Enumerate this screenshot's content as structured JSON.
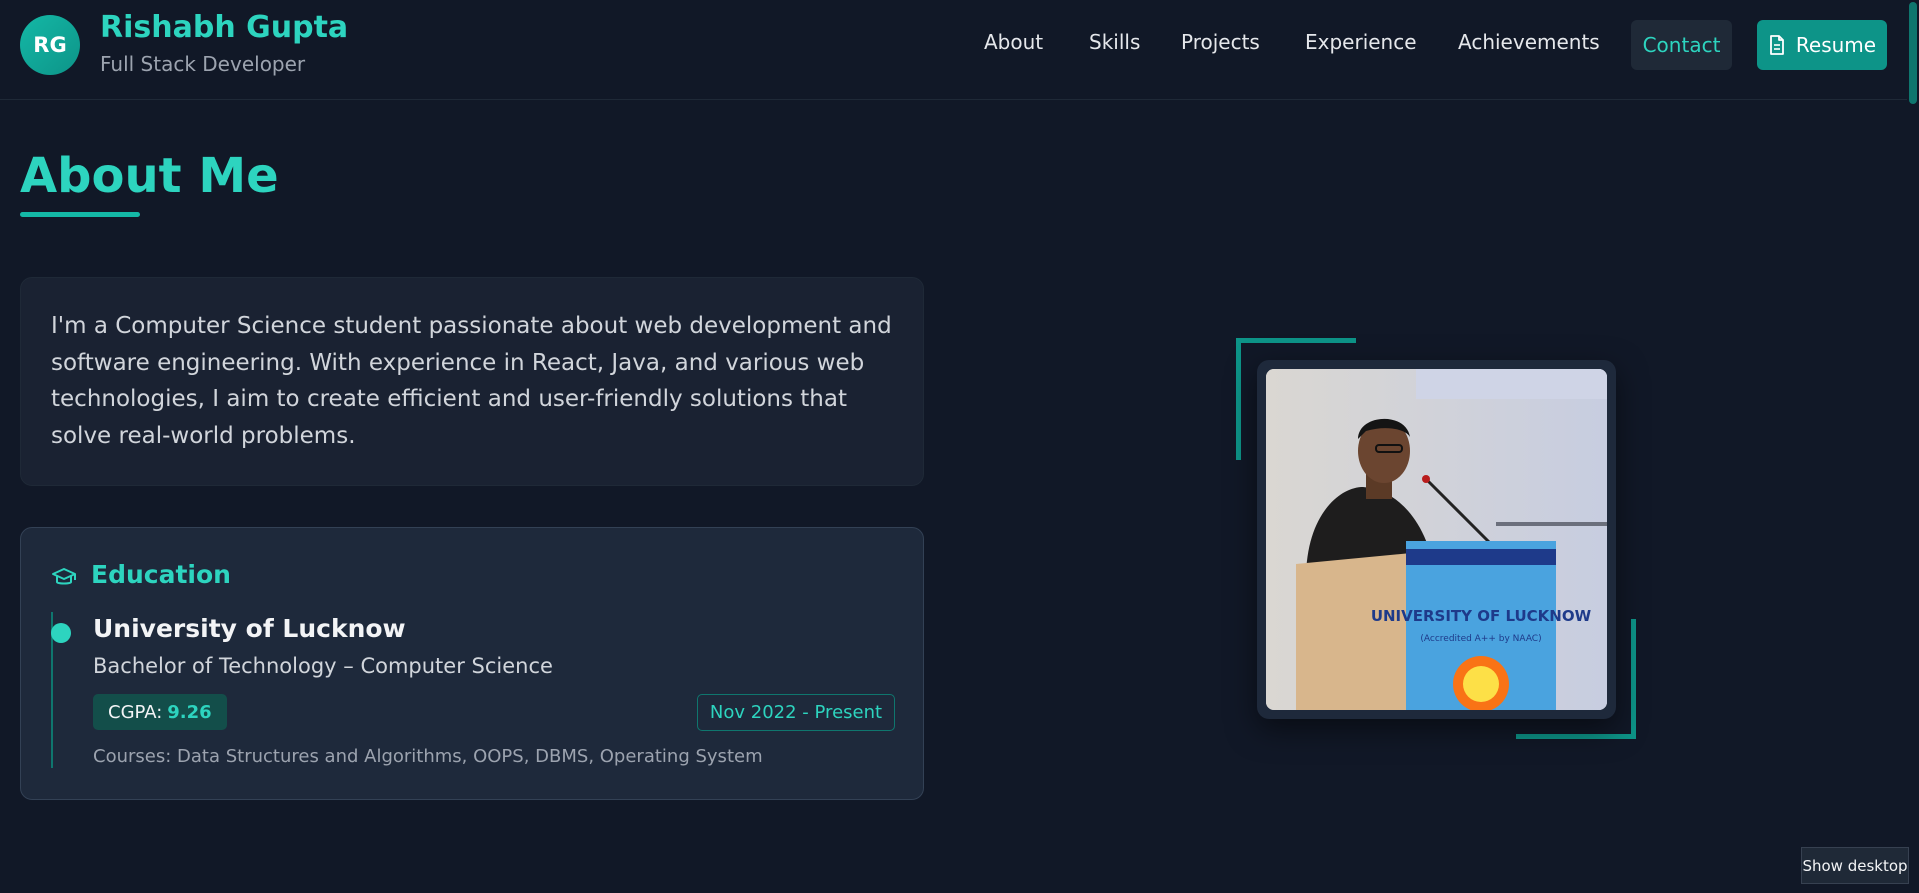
{
  "header": {
    "logo_initials": "RG",
    "name": "Rishabh Gupta",
    "subtitle": "Full Stack Developer",
    "nav": [
      "About",
      "Skills",
      "Projects",
      "Experience",
      "Achievements"
    ],
    "contact_label": "Contact",
    "resume_label": "Resume"
  },
  "about": {
    "title": "About Me",
    "bio": "I'm a Computer Science student passionate about web development and software engineering. With experience in React, Java, and various web technologies, I aim to create efficient and user-friendly solutions that solve real-world problems."
  },
  "education": {
    "heading": "Education",
    "institution": "University of Lucknow",
    "degree": "Bachelor of Technology – Computer Science",
    "cgpa_label": "CGPA:",
    "cgpa_value": "9.26",
    "duration": "Nov 2022 - Present",
    "courses": "Courses: Data Structures and Algorithms, OOPS, DBMS, Operating System"
  },
  "photo": {
    "podium_line1": "UNIVERSITY OF LUCKNOW",
    "podium_line2": "(Accredited A++ by NAAC)"
  },
  "taskbar": {
    "show_desktop": "Show desktop"
  },
  "colors": {
    "background": "#111827",
    "accent": "#2dd4bf",
    "accent_dark": "#0d9488",
    "card": "#1e293b"
  }
}
